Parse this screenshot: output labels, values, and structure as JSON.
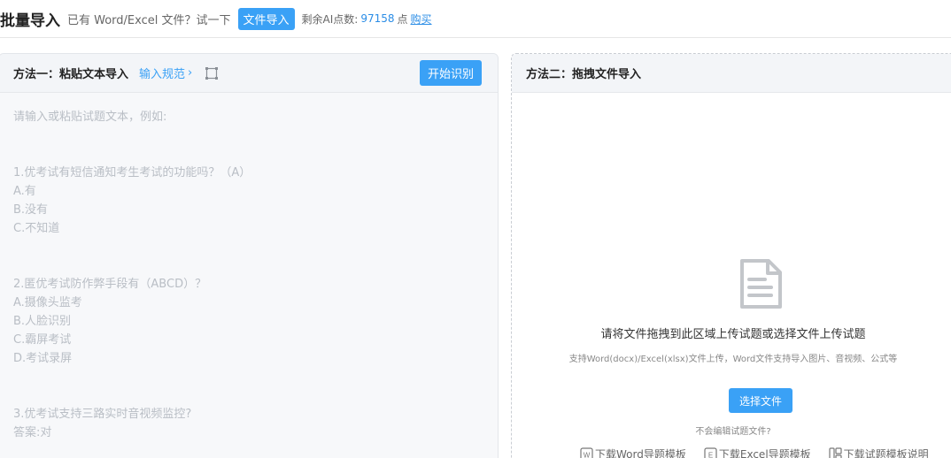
{
  "header": {
    "title": "批量导入",
    "hint": "已有 Word/Excel 文件？试一下",
    "import_button": "文件导入",
    "points_label": "剩余AI点数:",
    "points_value": "97158",
    "points_unit": "点",
    "buy_link": "购买"
  },
  "left_panel": {
    "title": "方法一：粘贴文本导入",
    "rule_link": "输入规范",
    "rule_chevron": "›",
    "expand_icon": "expand-icon",
    "start_button": "开始识别",
    "placeholder_lines": [
      "请输入或粘贴试题文本，例如:",
      "",
      "",
      "1.优考试有短信通知考生考试的功能吗？（A）",
      "A.有",
      "B.没有",
      "C.不知道",
      "",
      "",
      "2.匿优考试防作弊手段有（ABCD）？",
      "A.摄像头监考",
      "B.人脸识别",
      "C.霸屏考试",
      "D.考试录屏",
      "",
      "",
      "3.优考试支持三路实时音视频监控?",
      "答案:对"
    ]
  },
  "right_panel": {
    "title": "方法二：拖拽文件导入",
    "doc_icon": "document-icon",
    "drop_title": "请将文件拖拽到此区域上传试题或选择文件上传试题",
    "drop_sub": "支持Word(docx)/Excel(xlsx)文件上传，Word文件支持导入图片、音视频、公式等",
    "choose_button": "选择文件",
    "cannot_edit": "不会编辑试题文件?",
    "downloads": [
      {
        "icon": "word-file-icon",
        "label": "下载Word导题模板"
      },
      {
        "icon": "excel-file-icon",
        "label": "下载Excel导题模板"
      },
      {
        "icon": "layout-icon",
        "label": "下载试题模板说明"
      }
    ]
  },
  "colors": {
    "accent": "#3aa1f6",
    "link": "#2b8de6",
    "placeholder": "#b9bec5"
  }
}
